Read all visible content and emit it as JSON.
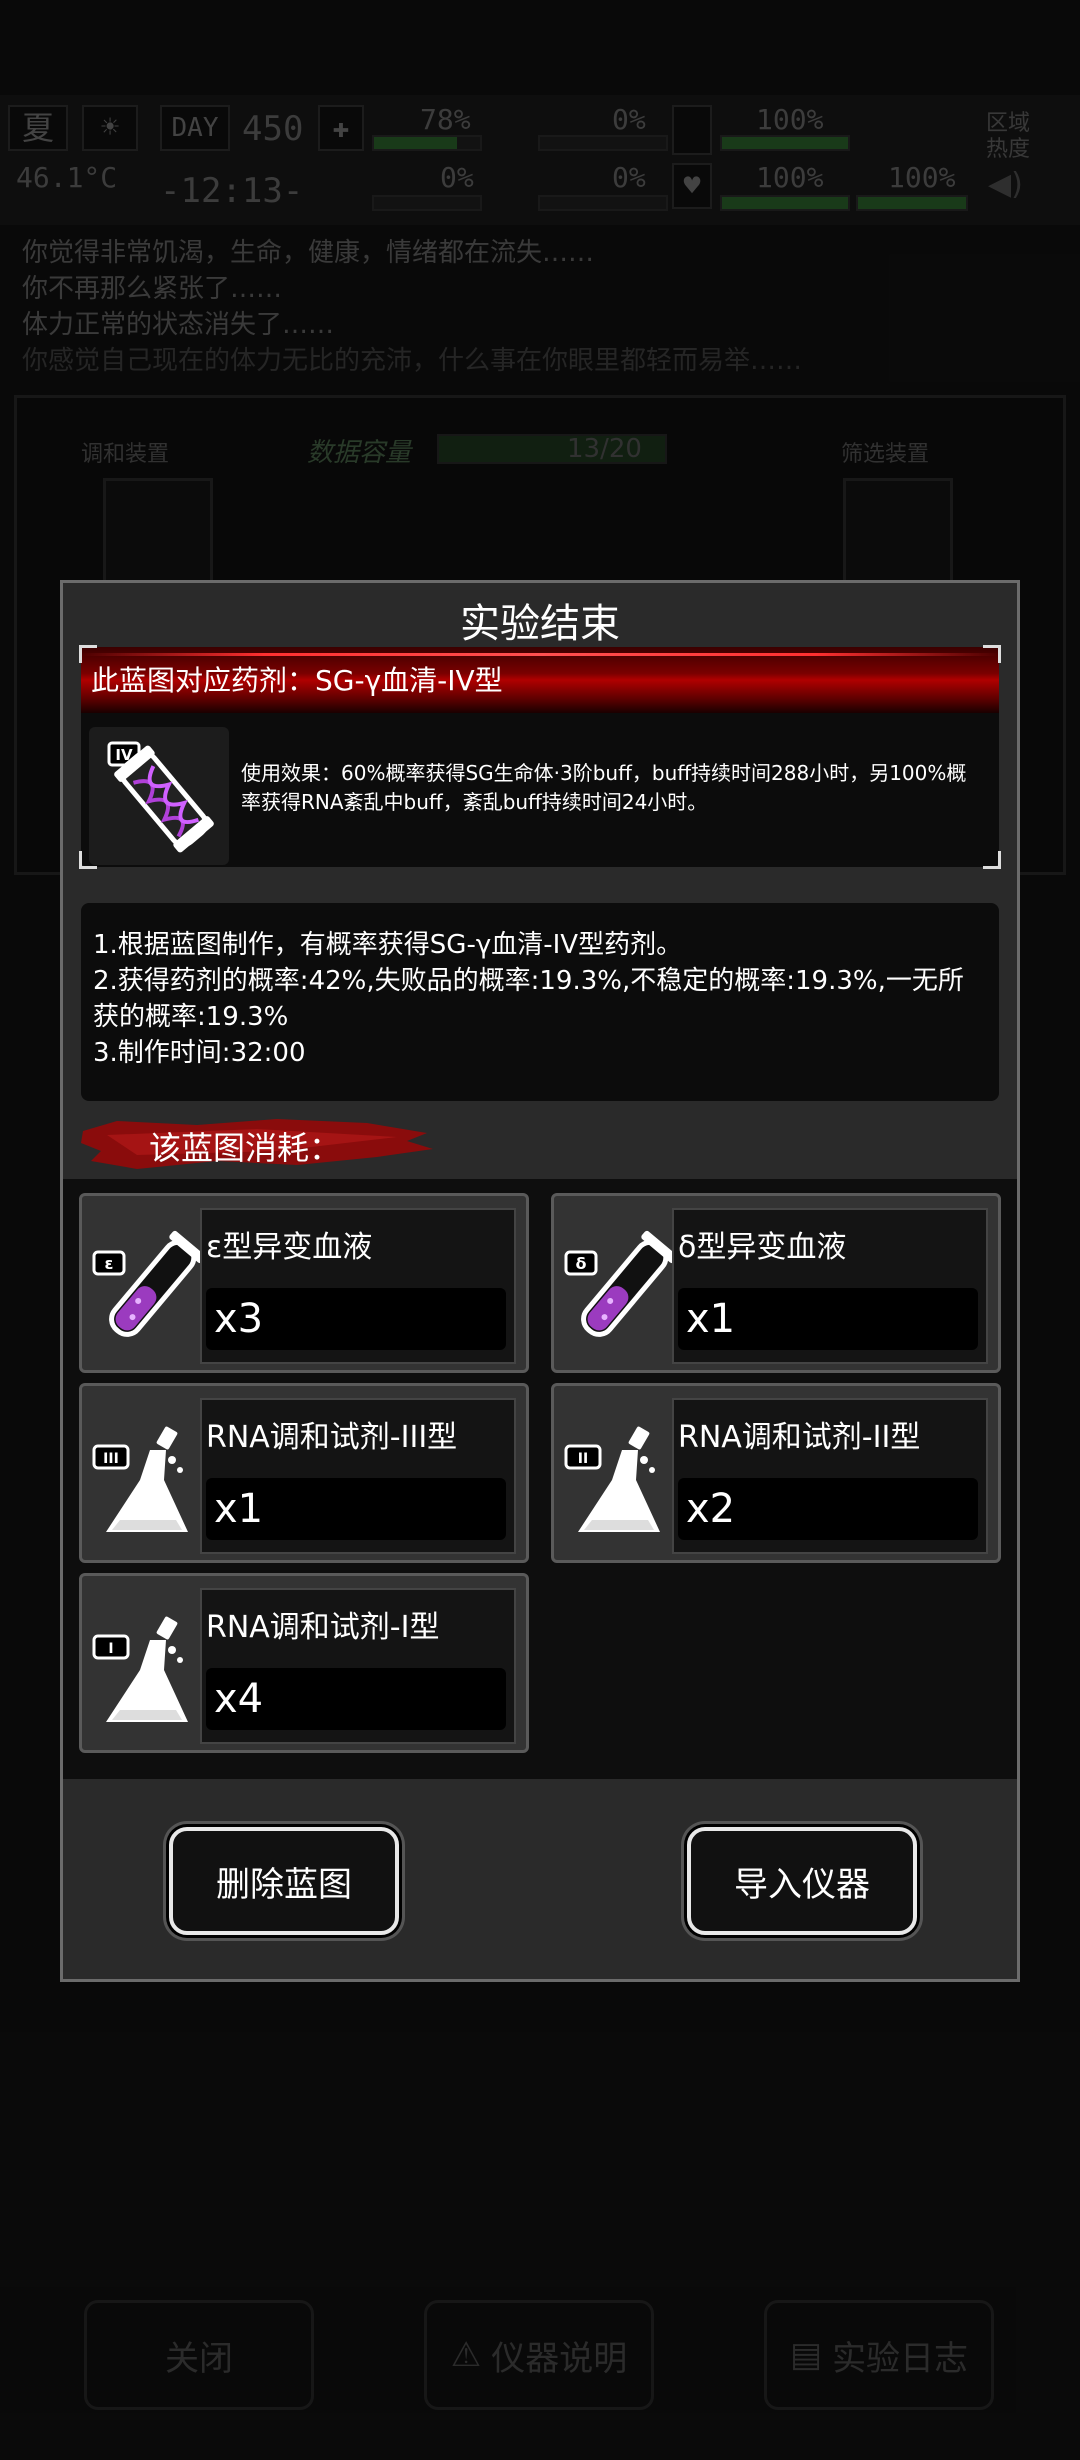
{
  "hud": {
    "season": "夏",
    "day_label": "DAY",
    "day_value": "450",
    "temperature": "46.1°C",
    "time": "-12:13-",
    "health_pct": "78%",
    "bleed_pct": "0%",
    "stat3_pct": "0%",
    "stat4_pct": "0%",
    "stomach_pct": "100%",
    "mood_pct": "100%",
    "stamina_pct": "100%",
    "region_label": "区域热度"
  },
  "messages": [
    "你觉得非常饥渴，生命，健康，情绪都在流失……",
    "你不再那么紧张了……",
    "体力正常的状态消失了……",
    "你感觉自己现在的体力无比的充沛，什么事在你眼里都轻而易举……"
  ],
  "background_panel": {
    "left_label": "调和装置",
    "center_label": "数据容量",
    "capacity": "13/20",
    "right_label": "筛选装置"
  },
  "bottom_buttons": {
    "close": "关闭",
    "instrument_info": "仪器说明",
    "lab_log": "实验日志"
  },
  "modal": {
    "title": "实验结束",
    "blueprint_name": "此蓝图对应药剂：SG-γ血清-IV型",
    "blueprint_effect": "使用效果：60%概率获得SG生命体·3阶buff，buff持续时间288小时，另100%概率获得RNA紊乱中buff，紊乱buff持续时间24小时。",
    "blueprint_tier": "IV",
    "description": [
      "1.根据蓝图制作，有概率获得SG-γ血清-IV型药剂。",
      "2.获得药剂的概率:42%,失败品的概率:19.3%,不稳定的概率:19.3%,一无所获的概率:19.3%",
      "3.制作时间:32:00"
    ],
    "consume_label": "该蓝图消耗：",
    "items": [
      {
        "name": "ε型异变血液",
        "qty": "x3",
        "tier": "ε"
      },
      {
        "name": "δ型异变血液",
        "qty": "x1",
        "tier": "δ"
      },
      {
        "name": "RNA调和试剂-III型",
        "qty": "x1",
        "tier": "III"
      },
      {
        "name": "RNA调和试剂-II型",
        "qty": "x2",
        "tier": "II"
      },
      {
        "name": "RNA调和试剂-I型",
        "qty": "x4",
        "tier": "I"
      }
    ],
    "delete_button": "删除蓝图",
    "import_button": "导入仪器"
  }
}
